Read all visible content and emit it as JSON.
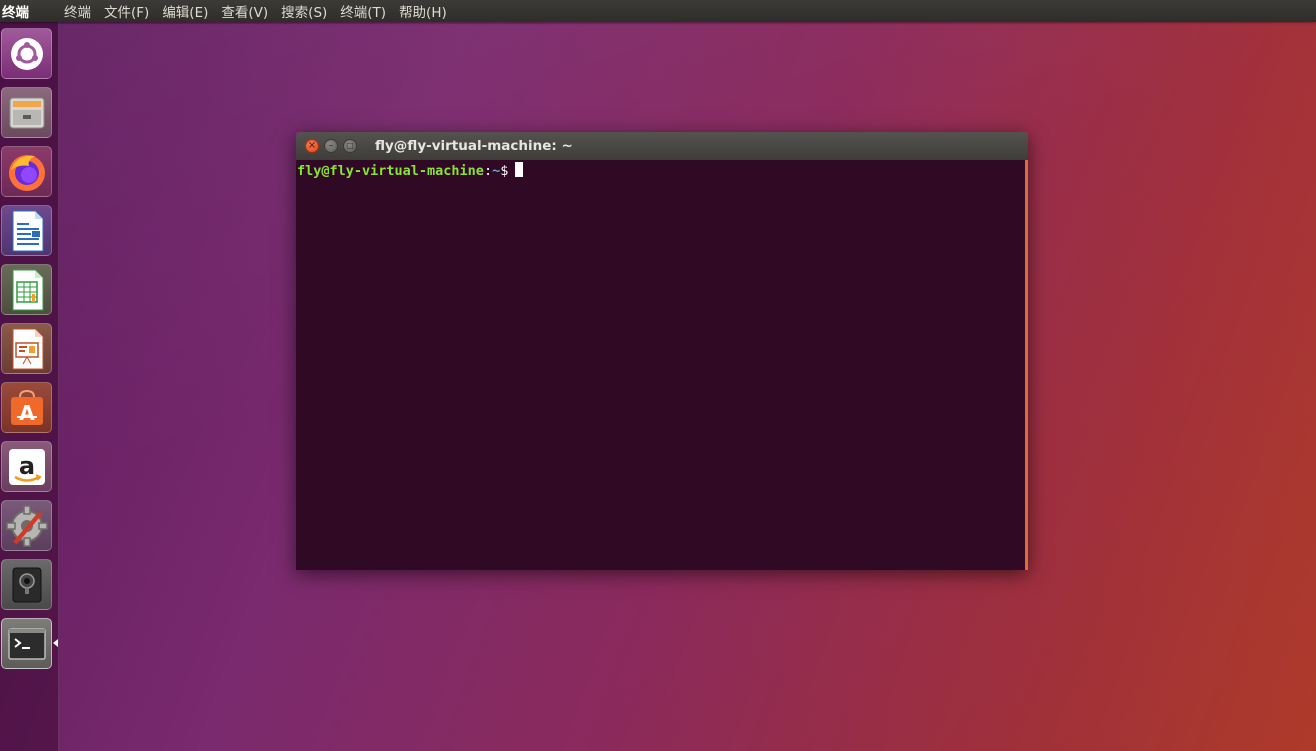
{
  "top_panel": {
    "app_name": "终端",
    "menu": [
      "终端",
      "文件(F)",
      "编辑(E)",
      "查看(V)",
      "搜索(S)",
      "终端(T)",
      "帮助(H)"
    ]
  },
  "launcher": {
    "items": [
      {
        "name": "ubuntu-dash-icon"
      },
      {
        "name": "files-icon"
      },
      {
        "name": "firefox-icon"
      },
      {
        "name": "libreoffice-writer-icon"
      },
      {
        "name": "libreoffice-calc-icon"
      },
      {
        "name": "libreoffice-impress-icon"
      },
      {
        "name": "ubuntu-software-icon"
      },
      {
        "name": "amazon-icon"
      },
      {
        "name": "system-settings-icon"
      },
      {
        "name": "webcam-icon"
      },
      {
        "name": "terminal-icon"
      }
    ]
  },
  "terminal": {
    "title": "fly@fly-virtual-machine: ~",
    "prompt_user": "fly@fly-virtual-machine",
    "prompt_colon": ":",
    "prompt_path": "~",
    "prompt_dollar": "$",
    "buttons": {
      "close": "×",
      "minimize": "–",
      "maximize": "□"
    }
  },
  "colors": {
    "terminal_bg": "#300a24",
    "prompt_green": "#8ae234",
    "prompt_blue": "#729fcf",
    "close_orange": "#df4a16"
  }
}
